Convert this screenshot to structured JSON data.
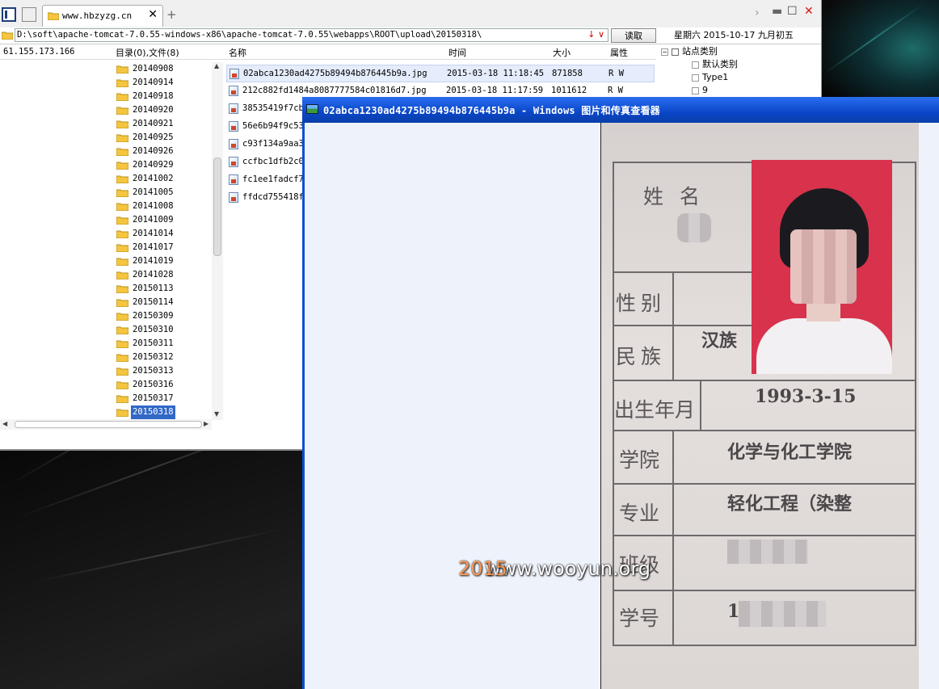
{
  "tab": {
    "title": "www.hbzyzg.cn"
  },
  "address": {
    "path": "D:\\soft\\apache-tomcat-7.0.55-windows-x86\\apache-tomcat-7.0.55\\webapps\\ROOT\\upload\\20150318\\",
    "arrows": "↓ ∨",
    "read_label": "读取"
  },
  "datebar": "星期六  2015-10-17  九月初五",
  "status": {
    "ip": "61.155.173.166",
    "summary": "目录(0),文件(8)"
  },
  "columns": {
    "name": "名称",
    "time": "时间",
    "size": "大小",
    "attr": "属性"
  },
  "tree": {
    "items": [
      "20140908",
      "20140914",
      "20140918",
      "20140920",
      "20140921",
      "20140925",
      "20140926",
      "20140929",
      "20141002",
      "20141005",
      "20141008",
      "20141009",
      "20141014",
      "20141017",
      "20141019",
      "20141028",
      "20150113",
      "20150114",
      "20150309",
      "20150310",
      "20150311",
      "20150312",
      "20150313",
      "20150316",
      "20150317",
      "20150318"
    ],
    "selected": "20150318"
  },
  "files": [
    {
      "name": "02abca1230ad4275b89494b876445b9a.jpg",
      "time": "2015-03-18 11:18:45",
      "size": "871858",
      "attr": "R W"
    },
    {
      "name": "212c882fd1484a8087777584c01816d7.jpg",
      "time": "2015-03-18 11:17:59",
      "size": "1011612",
      "attr": "R W"
    },
    {
      "name": "38535419f7cb",
      "time": "",
      "size": "",
      "attr": ""
    },
    {
      "name": "56e6b94f9c53",
      "time": "",
      "size": "",
      "attr": ""
    },
    {
      "name": "c93f134a9aa3",
      "time": "",
      "size": "",
      "attr": ""
    },
    {
      "name": "ccfbc1dfb2c0",
      "time": "",
      "size": "",
      "attr": ""
    },
    {
      "name": "fc1ee1fadcf7",
      "time": "",
      "size": "",
      "attr": ""
    },
    {
      "name": "ffdcd755418f",
      "time": "",
      "size": "",
      "attr": ""
    }
  ],
  "categories": {
    "root": "站点类别",
    "items": [
      "默认类别",
      "Type1",
      "9"
    ]
  },
  "viewer": {
    "title": "02abca1230ad4275b89494b876445b9a - Windows 图片和传真查看器"
  },
  "card": {
    "name_label": "姓 名",
    "gender_label": "性别",
    "ethnic_label": "民族",
    "ethnic_value": "汉族",
    "birth_label": "出生年月",
    "birth_value": "1993-3-15",
    "college_label": "学院",
    "college_value": "化学与化工学院",
    "major_label": "专业",
    "major_value": "轻化工程（染整",
    "class_label": "班级",
    "id_label": "学号",
    "id_prefix": "1"
  },
  "watermark": {
    "year": "2015",
    "site": "www.wooyun.org"
  }
}
